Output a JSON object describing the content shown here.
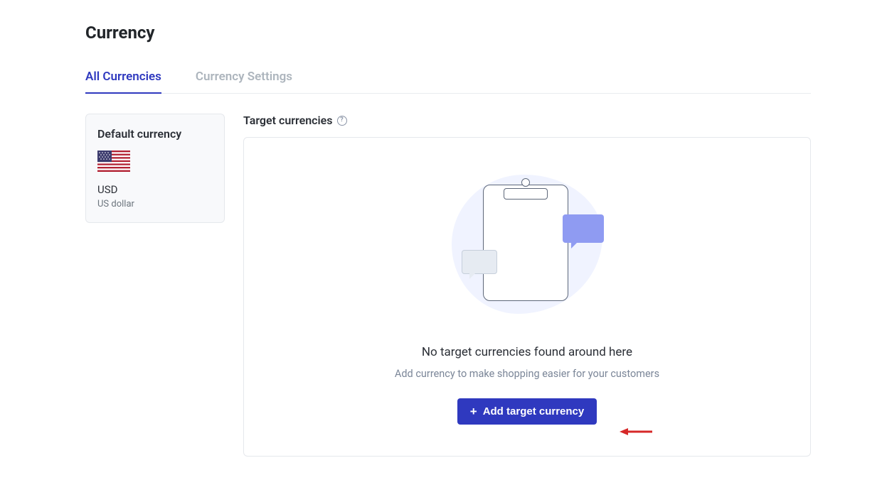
{
  "page": {
    "title": "Currency"
  },
  "tabs": {
    "all": "All Currencies",
    "settings": "Currency Settings"
  },
  "default_card": {
    "title": "Default currency",
    "code": "USD",
    "name": "US dollar"
  },
  "target": {
    "label": "Target currencies",
    "empty_title": "No target currencies found around here",
    "empty_sub": "Add currency to make shopping easier for your customers",
    "add_btn": "Add target currency"
  },
  "colors": {
    "accent": "#2f39bf"
  }
}
